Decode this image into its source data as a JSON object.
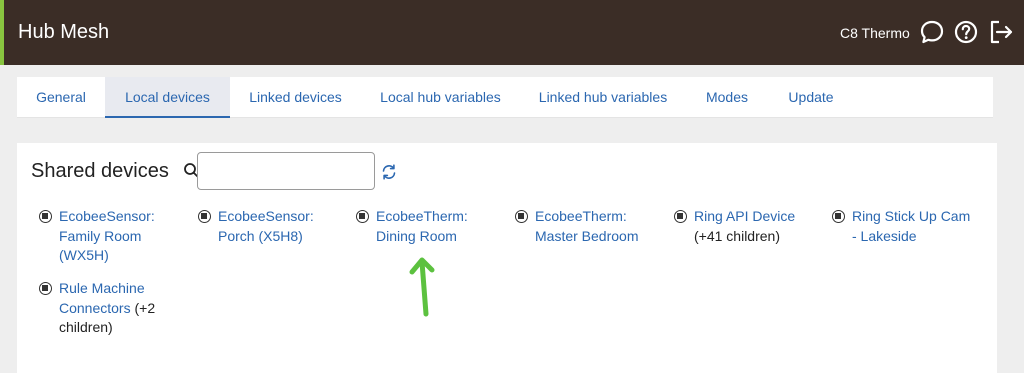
{
  "app": {
    "title": "Hub Mesh",
    "hub_name": "C8 Thermo"
  },
  "header_icons": [
    "chat-icon",
    "help-icon",
    "logout-icon"
  ],
  "tabs": [
    {
      "label": "General",
      "active": false
    },
    {
      "label": "Local devices",
      "active": true
    },
    {
      "label": "Linked devices",
      "active": false
    },
    {
      "label": "Local hub variables",
      "active": false
    },
    {
      "label": "Linked hub variables",
      "active": false
    },
    {
      "label": "Modes",
      "active": false
    },
    {
      "label": "Update",
      "active": false
    }
  ],
  "shared": {
    "title": "Shared devices",
    "search_value": "",
    "devices": [
      {
        "name": "EcobeeSensor: Family Room (WX5H)",
        "extra": ""
      },
      {
        "name": "EcobeeSensor: Porch (X5H8)",
        "extra": ""
      },
      {
        "name": "EcobeeTherm: Dining Room",
        "extra": ""
      },
      {
        "name": "EcobeeTherm: Master Bedroom",
        "extra": ""
      },
      {
        "name": "Ring API Device",
        "extra": " (+41 children)"
      },
      {
        "name": "Ring Stick Up Cam - Lakeside",
        "extra": ""
      },
      {
        "name": "Rule Machine Connectors",
        "extra": " (+2 children)"
      }
    ]
  },
  "colors": {
    "topbar": "#3b2d26",
    "accent": "#88c43f",
    "link": "#2b67b0",
    "annotation_arrow": "#5cc13f"
  }
}
